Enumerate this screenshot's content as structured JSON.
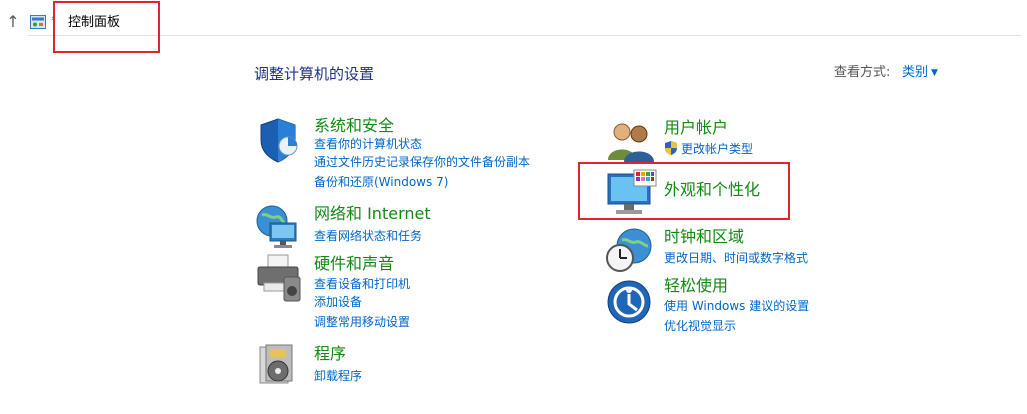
{
  "address": {
    "path": "控制面板"
  },
  "header": {
    "title": "调整计算机的设置",
    "view_by_label": "查看方式:",
    "view_by_value": "类别"
  },
  "categories": [
    {
      "title": "系统和安全",
      "icon": "shield-icon",
      "links": [
        "查看你的计算机状态",
        "通过文件历史记录保存你的文件备份副本",
        "备份和还原(Windows 7)"
      ]
    },
    {
      "title": "网络和 Internet",
      "icon": "network-globe-icon",
      "links": [
        "查看网络状态和任务"
      ]
    },
    {
      "title": "硬件和声音",
      "icon": "printer-icon",
      "links": [
        "查看设备和打印机",
        "添加设备",
        "调整常用移动设置"
      ]
    },
    {
      "title": "程序",
      "icon": "programs-icon",
      "links": [
        "卸载程序"
      ]
    },
    {
      "title": "用户帐户",
      "icon": "users-icon",
      "links": [
        "更改帐户类型"
      ]
    },
    {
      "title": "外观和个性化",
      "icon": "monitor-palette-icon",
      "links": []
    },
    {
      "title": "时钟和区域",
      "icon": "clock-globe-icon",
      "links": [
        "更改日期、时间或数字格式"
      ]
    },
    {
      "title": "轻松使用",
      "icon": "ease-of-access-icon",
      "links": [
        "使用 Windows 建议的设置",
        "优化视觉显示"
      ]
    }
  ],
  "colors": {
    "category_title": "#128a12",
    "link": "#0066cc",
    "highlight": "#e0262b",
    "title": "#1e3287"
  }
}
